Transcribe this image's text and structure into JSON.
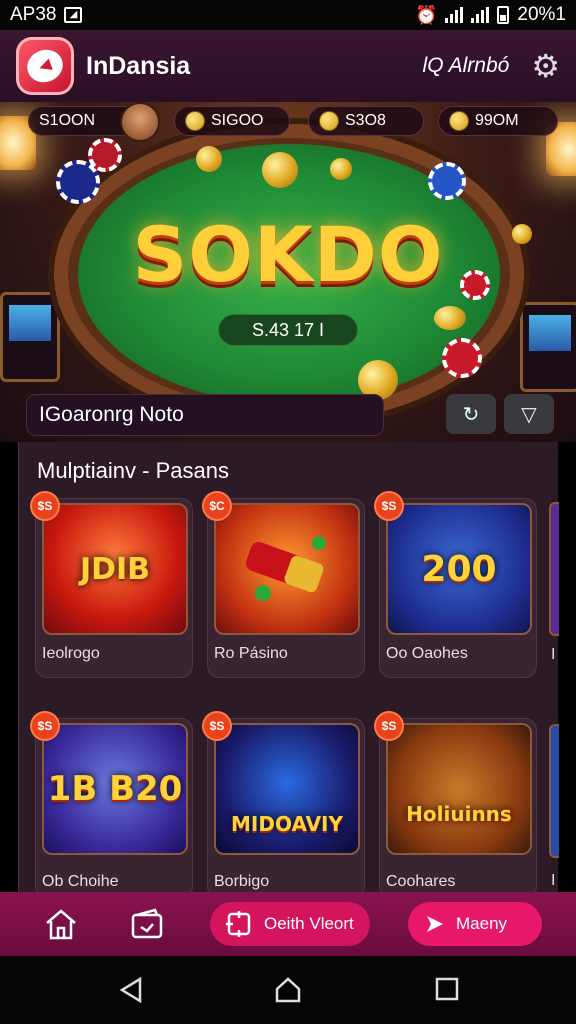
{
  "status_bar": {
    "time": "AP38",
    "battery_text": "20%1"
  },
  "app_bar": {
    "title": "InDansia",
    "user_label": "lQ Alrnbó",
    "logo_icon": "logo-icon",
    "settings_icon": "gear-icon"
  },
  "hero": {
    "balances": [
      "S1OON",
      "SIGOO",
      "S3O8",
      "99OM"
    ],
    "banner_title": "SOKDO",
    "jackpot_value": "S.43 17 I"
  },
  "search": {
    "placeholder": "IGoaronrg Noto",
    "filter_icon": "refresh-icon",
    "dropdown_icon": "chevron-down-icon"
  },
  "section": {
    "title": "Mulptiainv - Pasans"
  },
  "games": [
    {
      "badge": "$S",
      "art_text": "JDIB",
      "label": "Ieolrogo"
    },
    {
      "badge": "$C",
      "art_text": "",
      "label": "Ro Pásino"
    },
    {
      "badge": "$S",
      "art_text": "200",
      "label": "Oo Oaohes"
    },
    {
      "badge": "$S",
      "art_text": "1B B20",
      "label": "Ob Choihe"
    },
    {
      "badge": "$S",
      "art_text": "MIDOAVIY",
      "label": "Borbigo"
    },
    {
      "badge": "$S",
      "art_text": "Holiuinns",
      "label": "Coohares"
    }
  ],
  "bottom_nav": {
    "pill1_label": "Oeith Vleort",
    "pill2_label": "Maeny",
    "accent": "#d4145c"
  }
}
